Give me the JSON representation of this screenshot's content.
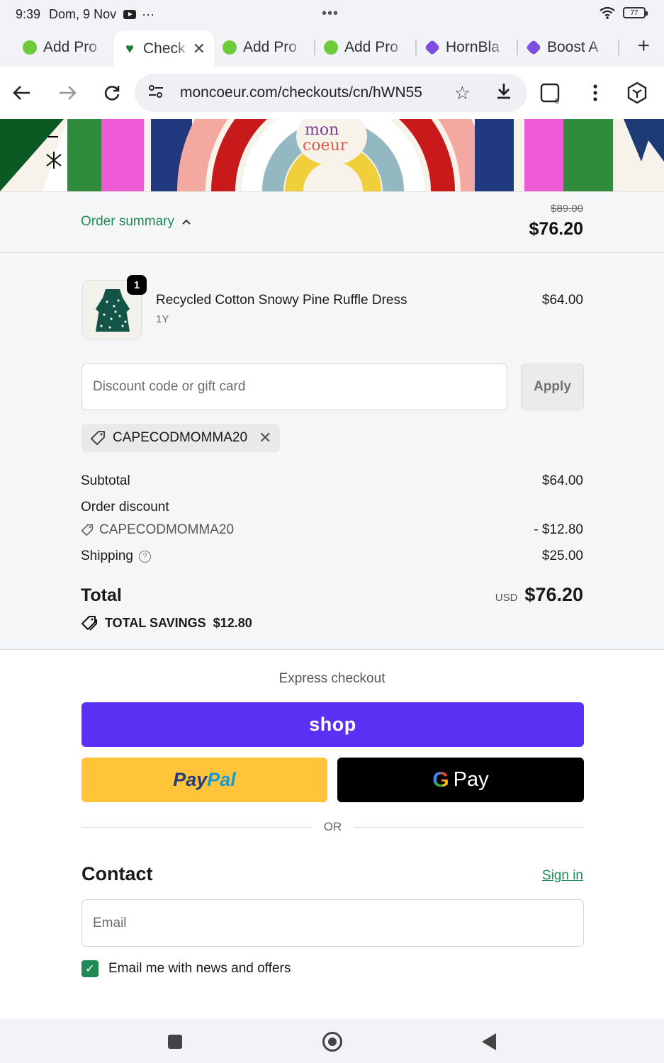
{
  "status_bar": {
    "time": "9:39",
    "date": "Dom, 9 Nov",
    "more": "···",
    "battery": "77"
  },
  "tabs": [
    {
      "label": "Add Pro",
      "favicon": "green-leaf-icon"
    },
    {
      "label": "Check",
      "favicon": "heart-icon",
      "active": true
    },
    {
      "label": "Add Pro",
      "favicon": "green-leaf-icon"
    },
    {
      "label": "Add Pro",
      "favicon": "green-leaf-icon"
    },
    {
      "label": "HornBla",
      "favicon": "purple-badge-icon"
    },
    {
      "label": "Boost A",
      "favicon": "purple-badge-icon"
    }
  ],
  "toolbar": {
    "url": "moncoeur.com/checkouts/cn/hWN55",
    "tab_count": "6"
  },
  "summary": {
    "toggle_label": "Order summary",
    "original_price": "$89.00",
    "price": "$76.20"
  },
  "product": {
    "name": "Recycled Cotton Snowy Pine Ruffle Dress",
    "variant": "1Y",
    "price": "$64.00",
    "quantity": "1"
  },
  "discount": {
    "placeholder": "Discount code or gift card",
    "apply_label": "Apply",
    "applied_code": "CAPECODMOMMA20"
  },
  "totals": {
    "subtotal_label": "Subtotal",
    "subtotal": "$64.00",
    "order_discount_label": "Order discount",
    "discount_code": "CAPECODMOMMA20",
    "discount_amount": "- $12.80",
    "shipping_label": "Shipping",
    "shipping": "$25.00",
    "total_label": "Total",
    "currency": "USD",
    "total": "$76.20",
    "savings_label": "TOTAL SAVINGS",
    "savings": "$12.80"
  },
  "express": {
    "title": "Express checkout",
    "shop_label": "shop",
    "paypal_a": "Pay",
    "paypal_b": "Pal",
    "gpay_label": "Pay",
    "or_label": "OR"
  },
  "contact": {
    "title": "Contact",
    "signin_label": "Sign in",
    "email_placeholder": "Email",
    "newsletter_label": "Email me with news and offers",
    "newsletter_checked": true
  },
  "colors": {
    "accent": "#1f8a55",
    "shop": "#5a31f4",
    "paypal": "#ffc439"
  }
}
